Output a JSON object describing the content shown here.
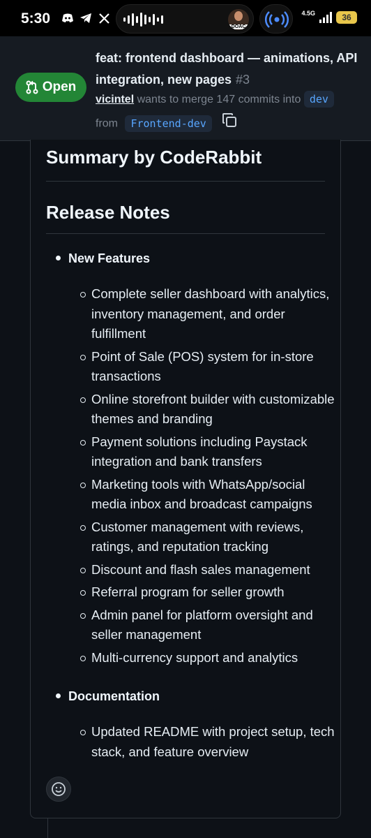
{
  "status_bar": {
    "time": "5:30",
    "left_icons": [
      "discord-icon",
      "telegram-icon",
      "x-icon"
    ],
    "island_badge": "DOAC",
    "network": "4.5G",
    "battery": "36"
  },
  "pr": {
    "state_label": "Open",
    "title": "feat: frontend dashboard — animations, API integration, new pages",
    "number": "#3",
    "author": "vicintel",
    "merge_text": "wants to merge 147 commits into",
    "base_branch": "dev",
    "from_text": "from",
    "head_branch": "Frontend-dev"
  },
  "comment": {
    "heading": "Summary by CodeRabbit",
    "subheading": "Release Notes",
    "sections": [
      {
        "title": "New Features",
        "items": [
          "Complete seller dashboard with analytics, inventory management, and order fulfillment",
          "Point of Sale (POS) system for in-store transactions",
          "Online storefront builder with customizable themes and branding",
          "Payment solutions including Paystack integration and bank transfers",
          "Marketing tools with WhatsApp/social media inbox and broadcast campaigns",
          "Customer management with reviews, ratings, and reputation tracking",
          "Discount and flash sales management",
          "Referral program for seller growth",
          "Admin panel for platform oversight and seller management",
          "Multi-currency support and analytics"
        ]
      },
      {
        "title": "Documentation",
        "items": [
          "Updated README with project setup, tech stack, and feature overview"
        ]
      }
    ]
  },
  "colors": {
    "background": "#0d1117",
    "header": "#161b22",
    "open_green": "#238636",
    "branch_blue": "#58a6ff",
    "muted": "#7d8590"
  }
}
